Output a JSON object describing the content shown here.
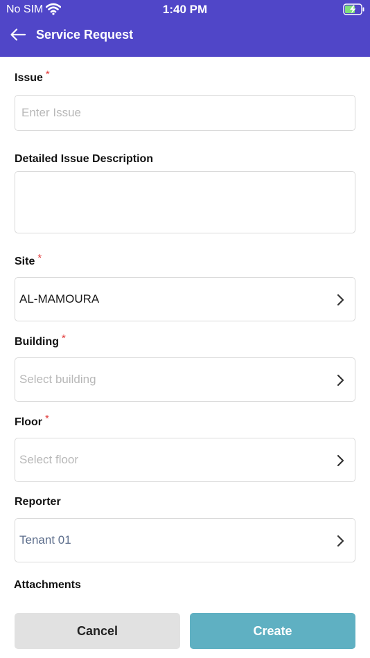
{
  "status_bar": {
    "carrier": "No SIM",
    "time": "1:40 PM"
  },
  "header": {
    "title": "Service Request"
  },
  "form": {
    "issue": {
      "label": "Issue",
      "required_mark": "*",
      "placeholder": "Enter Issue"
    },
    "description": {
      "label": "Detailed Issue Description",
      "value": ""
    },
    "site": {
      "label": "Site",
      "required_mark": "*",
      "value": "AL-MAMOURA"
    },
    "building": {
      "label": "Building",
      "required_mark": "*",
      "placeholder": "Select building"
    },
    "floor": {
      "label": "Floor",
      "required_mark": "*",
      "placeholder": "Select floor"
    },
    "reporter": {
      "label": "Reporter",
      "value": "Tenant 01"
    },
    "attachments": {
      "label": "Attachments"
    }
  },
  "actions": {
    "cancel_label": "Cancel",
    "create_label": "Create"
  },
  "colors": {
    "header": "#5046c8",
    "create_button": "#5fb0c2",
    "cancel_button": "#e1e1e1",
    "required": "#e23b3b"
  }
}
